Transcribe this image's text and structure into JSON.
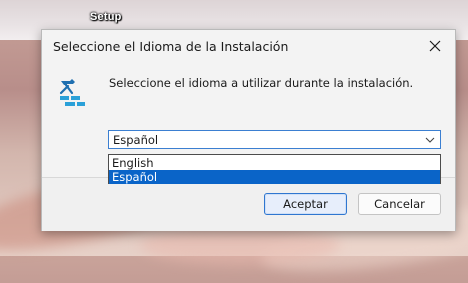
{
  "window": {
    "title": "Setup"
  },
  "dialog": {
    "title": "Seleccione el Idioma de la Instalación",
    "prompt": "Seleccione el idioma a utilizar durante la instalación.",
    "language_select": {
      "selected": "Español",
      "options": [
        "English",
        "Español"
      ],
      "highlighted": "Español"
    },
    "buttons": {
      "ok_label": "Aceptar",
      "cancel_label": "Cancelar"
    }
  },
  "colors": {
    "accent": "#0a64c8",
    "focus_border": "#2f76d0"
  }
}
